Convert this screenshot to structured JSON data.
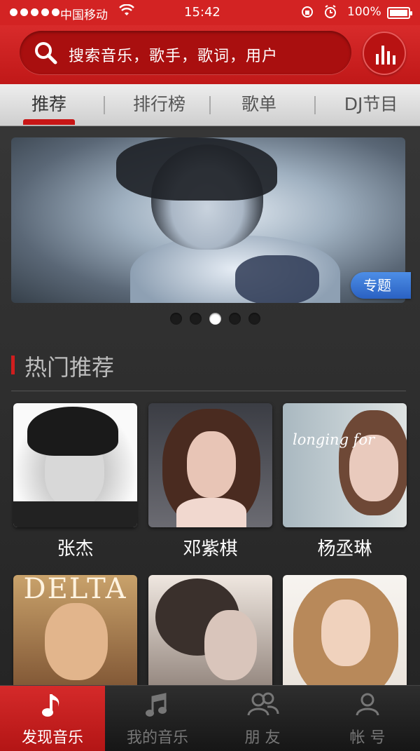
{
  "status_bar": {
    "carrier": "中国移动",
    "time": "15:42",
    "battery_percent": "100%",
    "battery_level": 1.0
  },
  "search": {
    "placeholder": "搜索音乐，歌手，歌词，用户"
  },
  "tabs": [
    {
      "label": "推荐",
      "active": true
    },
    {
      "label": "排行榜",
      "active": false
    },
    {
      "label": "歌单",
      "active": false
    },
    {
      "label": "DJ节目",
      "active": false
    }
  ],
  "banner": {
    "badge": "专题",
    "page_count": 5,
    "current_page": 3
  },
  "section": {
    "title": "热门推荐"
  },
  "recommendations": [
    {
      "name": "张杰"
    },
    {
      "name": "邓紫棋"
    },
    {
      "name": "杨丞琳",
      "cover_text": "longing for"
    },
    {
      "name": "",
      "cover_text": "DELTA"
    },
    {
      "name": ""
    },
    {
      "name": ""
    }
  ],
  "bottom_nav": [
    {
      "label": "发现音乐",
      "icon": "music-note-icon",
      "active": true
    },
    {
      "label": "我的音乐",
      "icon": "double-note-icon",
      "active": false
    },
    {
      "label": "朋  友",
      "icon": "friends-icon",
      "active": false
    },
    {
      "label": "帐  号",
      "icon": "account-icon",
      "active": false
    }
  ],
  "colors": {
    "brand_red": "#d32323",
    "badge_blue": "#3a78d8"
  }
}
